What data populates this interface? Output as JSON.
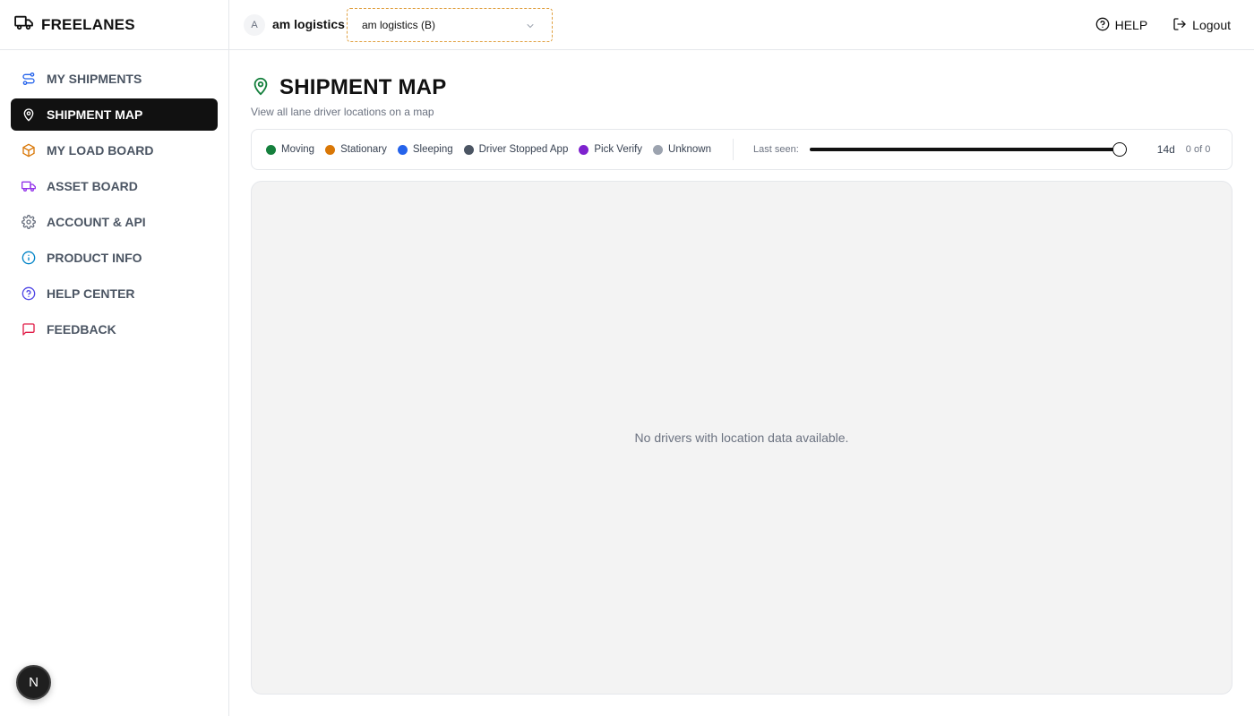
{
  "app": {
    "brand": "FREELANES"
  },
  "sidebar": {
    "items": [
      {
        "label": "MY SHIPMENTS",
        "icon": "route-icon",
        "color": "#2563eb"
      },
      {
        "label": "SHIPMENT MAP",
        "icon": "map-pin-icon",
        "color": "#ffffff",
        "active": true
      },
      {
        "label": "MY LOAD BOARD",
        "icon": "package-icon",
        "color": "#d97706"
      },
      {
        "label": "ASSET BOARD",
        "icon": "truck-icon",
        "color": "#9333ea"
      },
      {
        "label": "ACCOUNT & API",
        "icon": "gear-icon",
        "color": "#6b7280"
      },
      {
        "label": "PRODUCT INFO",
        "icon": "info-icon",
        "color": "#0284c7"
      },
      {
        "label": "HELP CENTER",
        "icon": "help-circle-icon",
        "color": "#4f46e5"
      },
      {
        "label": "FEEDBACK",
        "icon": "message-square-icon",
        "color": "#e11d48"
      }
    ],
    "bottom_badge": "N"
  },
  "header": {
    "avatar_initial": "A",
    "org_name": "am logistics",
    "org_select_value": "am logistics (B)",
    "help_label": "HELP",
    "logout_label": "Logout"
  },
  "page": {
    "title": "SHIPMENT MAP",
    "subtitle": "View all lane driver locations on a map"
  },
  "legend": {
    "items": [
      {
        "label": "Moving",
        "color": "#15803d"
      },
      {
        "label": "Stationary",
        "color": "#d97706"
      },
      {
        "label": "Sleeping",
        "color": "#2563eb"
      },
      {
        "label": "Driver Stopped App",
        "color": "#4b5563"
      },
      {
        "label": "Pick Verify",
        "color": "#7e22ce"
      },
      {
        "label": "Unknown",
        "color": "#9ca3af"
      }
    ],
    "last_seen_label": "Last seen:",
    "slider_value_label": "14d",
    "slider_fraction": 1.0,
    "count_label": "0 of 0"
  },
  "map": {
    "empty_message": "No drivers with location data available."
  }
}
